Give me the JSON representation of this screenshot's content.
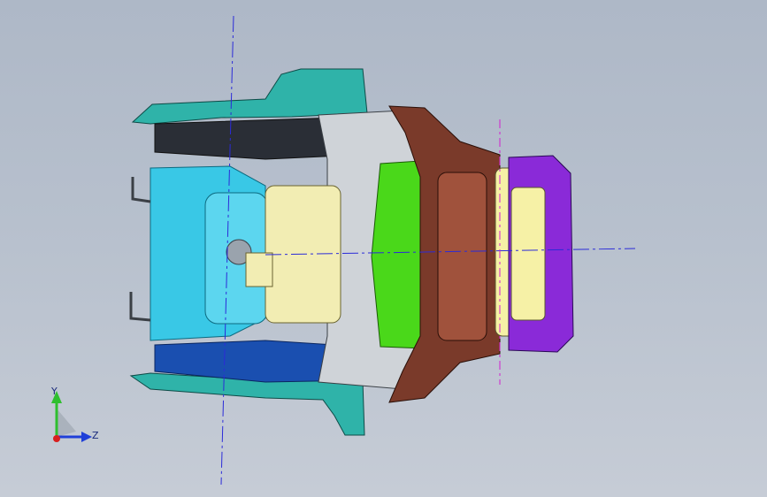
{
  "viewport": {
    "background_top": "#aeb8c7",
    "background_bottom": "#c6ccd6",
    "centerline_color": "#2b2bd8",
    "secondary_centerline_color": "#d020d0"
  },
  "model": {
    "colors": {
      "teal_shell": "#2fb3a9",
      "cyan_panel": "#39c8e6",
      "dark_panel": "#2a2e36",
      "blue_panel": "#1a4fb0",
      "cream_block": "#f2edb3",
      "grey_frame": "#cfd3d8",
      "brown_frame": "#7a3a2a",
      "green_core": "#4ad81a",
      "purple_cap": "#8a2ad8",
      "pale_yellow": "#f6f1a6"
    }
  },
  "triad": {
    "y_label": "Y",
    "z_label": "Z",
    "y_color": "#2fbf2f",
    "z_color": "#1f3fd8",
    "x_color": "#d81f1f"
  }
}
